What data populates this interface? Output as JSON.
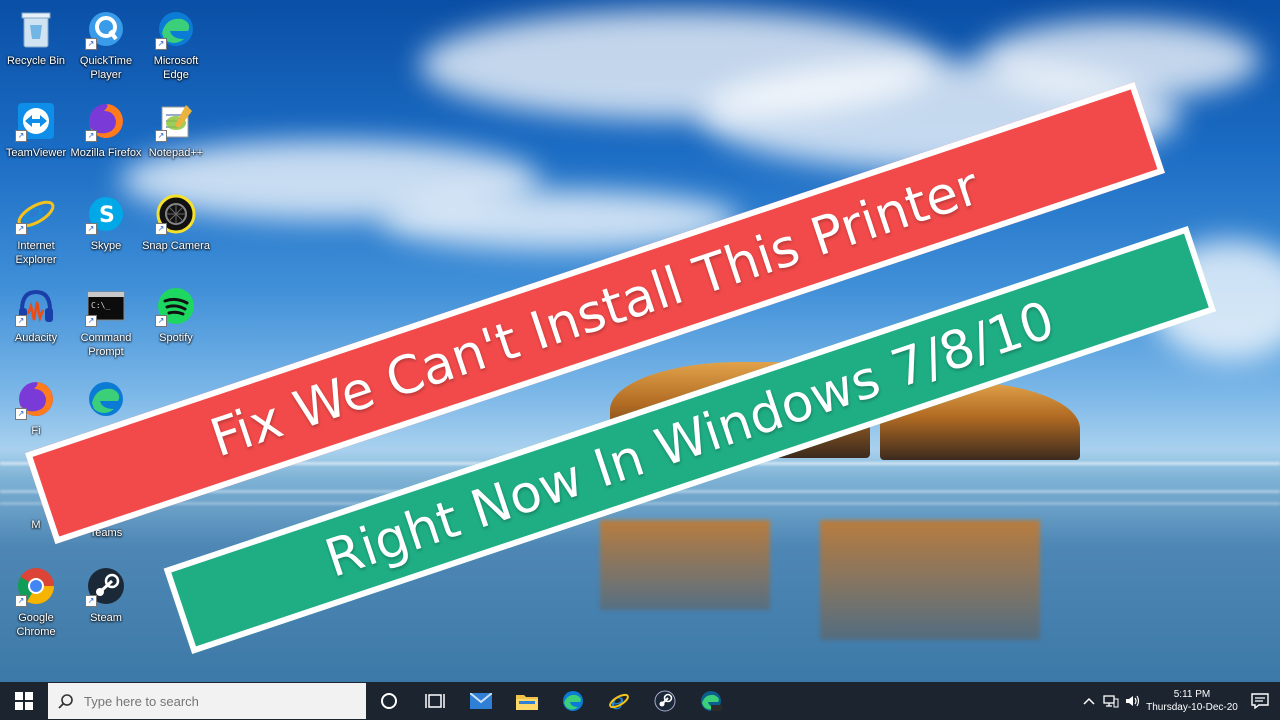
{
  "desktop": {
    "icons": [
      {
        "id": "recycle-bin",
        "label": "Recycle Bin",
        "icon": "recycle-bin-icon"
      },
      {
        "id": "quicktime",
        "label": "QuickTime Player",
        "icon": "quicktime-icon"
      },
      {
        "id": "edge",
        "label": "Microsoft Edge",
        "icon": "edge-icon"
      },
      {
        "id": "teamviewer",
        "label": "TeamViewer",
        "icon": "teamviewer-icon"
      },
      {
        "id": "firefox",
        "label": "Mozilla Firefox",
        "icon": "firefox-icon"
      },
      {
        "id": "notepadpp",
        "label": "Notepad++",
        "icon": "notepad-plus-plus-icon"
      },
      {
        "id": "ie",
        "label": "Internet Explorer",
        "icon": "internet-explorer-icon"
      },
      {
        "id": "skype",
        "label": "Skype",
        "icon": "skype-icon"
      },
      {
        "id": "snapcamera",
        "label": "Snap Camera",
        "icon": "snap-camera-icon"
      },
      {
        "id": "audacity",
        "label": "Audacity",
        "icon": "audacity-icon"
      },
      {
        "id": "cmd",
        "label": "Command Prompt",
        "icon": "command-prompt-icon"
      },
      {
        "id": "spotify",
        "label": "Spotify",
        "icon": "spotify-icon"
      },
      {
        "id": "firefox2",
        "label": "Fi",
        "icon": "firefox-icon"
      },
      {
        "id": "edge2",
        "label": "",
        "icon": "edge-icon"
      },
      {
        "id": "app-partial",
        "label": "M",
        "icon": "app-icon"
      },
      {
        "id": "teams",
        "label": "Teams",
        "icon": "teams-icon"
      },
      {
        "id": "chrome",
        "label": "Google Chrome",
        "icon": "chrome-icon"
      },
      {
        "id": "steam",
        "label": "Steam",
        "icon": "steam-icon"
      }
    ]
  },
  "banners": {
    "line1": "Fix We Can't Install This Printer",
    "line2": "Right Now In Windows 7/8/10",
    "color1": "#f24a4a",
    "color2": "#1fae84"
  },
  "taskbar": {
    "search_placeholder": "Type here to search",
    "pinned": [
      "cortana-icon",
      "task-view-icon",
      "mail-icon",
      "file-explorer-icon",
      "edge-icon",
      "internet-explorer-icon",
      "steam-icon",
      "edge-dev-icon"
    ],
    "clock": {
      "time": "5:11 PM",
      "date": "Thursday-10-Dec-20"
    }
  }
}
